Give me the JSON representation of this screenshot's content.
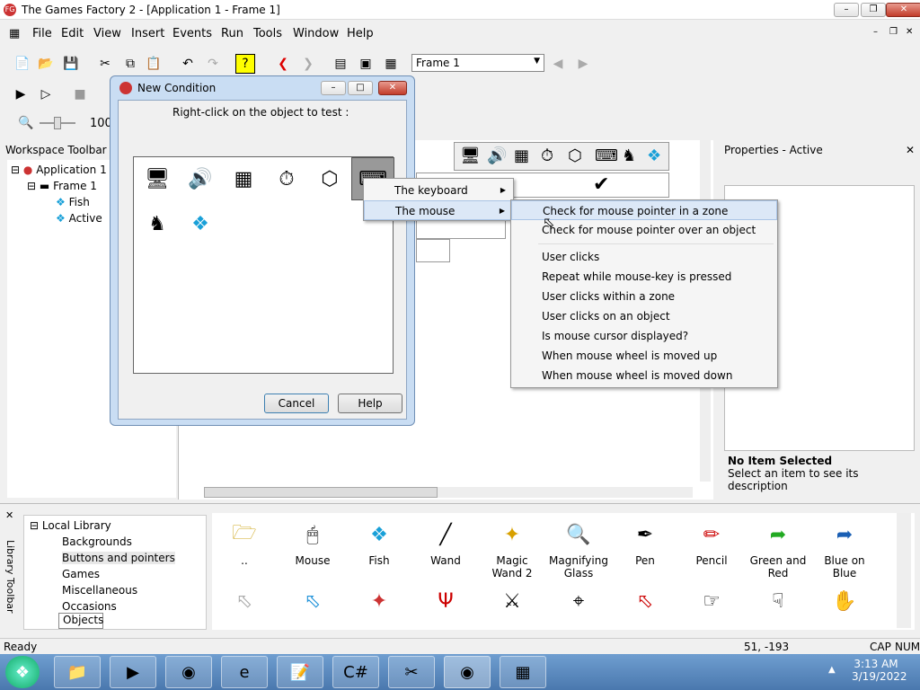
{
  "window": {
    "title": "The Games Factory 2 - [Application 1 - Frame 1]",
    "app_icon": "tgf-logo-icon"
  },
  "menu": [
    "File",
    "Edit",
    "View",
    "Insert",
    "Events",
    "Run",
    "Tools",
    "Window",
    "Help"
  ],
  "toolbar": {
    "frame_select": "Frame 1",
    "zoom": "100"
  },
  "workspace": {
    "title": "Workspace Toolbar",
    "tree": [
      {
        "label": "Application 1",
        "icon": "app-icon"
      },
      {
        "label": "Frame 1",
        "icon": "frame-icon"
      },
      {
        "label": "Fish",
        "icon": "fish-icon"
      },
      {
        "label": "Active",
        "icon": "fish-icon"
      }
    ]
  },
  "properties": {
    "title": "Properties - Active",
    "desc_title": "No Item Selected",
    "desc_text": "Select an item to see its description"
  },
  "dialog": {
    "title": "New Condition",
    "prompt": "Right-click on the object to test :",
    "cancel": "Cancel",
    "help": "Help"
  },
  "submenu1": [
    "The keyboard",
    "The mouse"
  ],
  "submenu2": [
    "Check for mouse pointer in a zone",
    "Check for mouse pointer over an object",
    "User clicks",
    "Repeat while mouse-key is pressed",
    "User clicks within a zone",
    "User clicks on an object",
    "Is mouse cursor displayed?",
    "When mouse wheel is moved up",
    "When mouse wheel is moved down"
  ],
  "library": {
    "side_label": "Library Toolbar",
    "tree": [
      "Local Library",
      "Backgrounds",
      "Buttons and pointers",
      "Games",
      "Miscellaneous",
      "Occasions"
    ],
    "tab": "Objects",
    "items": [
      "..",
      "Mouse",
      "Fish",
      "Wand",
      "Magic Wand 2",
      "Magnifying Glass",
      "Pen",
      "Pencil",
      "Green and Red",
      "Blue on Blue"
    ]
  },
  "status": {
    "left": "Ready",
    "coords": "51, -193",
    "caps": "CAP",
    "num": "NUM"
  },
  "taskbar": {
    "time": "3:13 AM",
    "date": "3/19/2022"
  }
}
